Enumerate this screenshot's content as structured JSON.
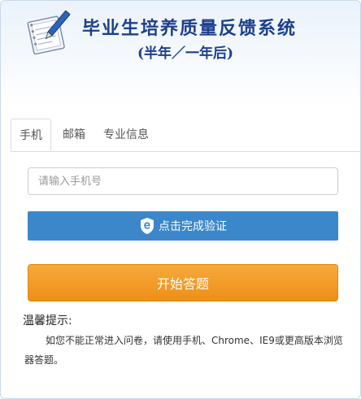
{
  "header": {
    "logo_icon": "notebook-pen-icon",
    "title": "毕业生培养质量反馈系统",
    "subtitle": "(半年／一年后)"
  },
  "tabs": [
    {
      "label": "手机",
      "active": true
    },
    {
      "label": "邮箱",
      "active": false
    },
    {
      "label": "专业信息",
      "active": false
    }
  ],
  "phone": {
    "placeholder": "请输入手机号",
    "value": ""
  },
  "verify": {
    "icon": "shield-e-icon",
    "label": "点击完成验证"
  },
  "start": {
    "label": "开始答题"
  },
  "tips": {
    "title": "温馨提示:",
    "text": "如您不能正常进入问卷，请使用手机、Chrome、IE9或更高版本浏览器答题。"
  },
  "colors": {
    "title": "#1c3f8c",
    "verify_bg": "#3b87c9",
    "start_bg": "#ee8f16"
  }
}
